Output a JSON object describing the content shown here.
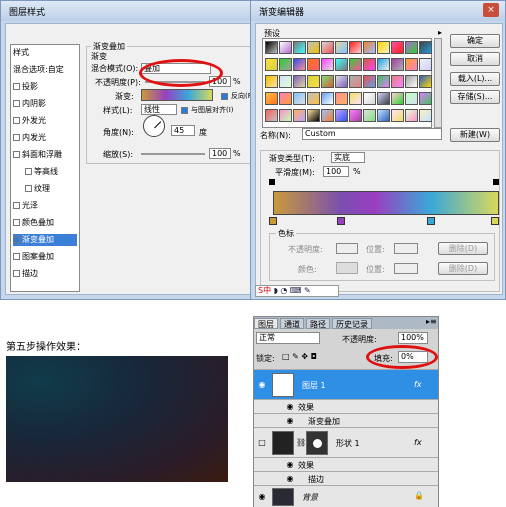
{
  "layer_style": {
    "title": "图层样式",
    "left_items": [
      {
        "label": "样式",
        "check": false,
        "sel": false,
        "nobox": true
      },
      {
        "label": "混合选项:自定",
        "check": false,
        "sel": false,
        "nobox": true
      },
      {
        "label": "投影",
        "check": false,
        "sel": false
      },
      {
        "label": "内阴影",
        "check": false,
        "sel": false
      },
      {
        "label": "外发光",
        "check": false,
        "sel": false
      },
      {
        "label": "内发光",
        "check": false,
        "sel": false
      },
      {
        "label": "斜面和浮雕",
        "check": false,
        "sel": false
      },
      {
        "label": "等高线",
        "check": false,
        "sel": false,
        "indent": true
      },
      {
        "label": "纹理",
        "check": false,
        "sel": false,
        "indent": true
      },
      {
        "label": "光泽",
        "check": false,
        "sel": false
      },
      {
        "label": "颜色叠加",
        "check": false,
        "sel": false
      },
      {
        "label": "渐变叠加",
        "check": true,
        "sel": true
      },
      {
        "label": "图案叠加",
        "check": false,
        "sel": false
      },
      {
        "label": "描边",
        "check": false,
        "sel": false
      }
    ],
    "section_title": "渐变叠加",
    "sub_title": "渐变",
    "blend_label": "混合模式(O):",
    "blend_value": "叠加",
    "opacity_label": "不透明度(P):",
    "opacity_value": "100",
    "pct": "%",
    "gradient_label": "渐变:",
    "reverse_label": "反向(R)",
    "style_label": "样式(L):",
    "style_value": "线性",
    "align_label": "与图层对齐(I)",
    "angle_label": "角度(N):",
    "angle_value": "45",
    "degree": "度",
    "scale_label": "缩放(S):",
    "scale_value": "100"
  },
  "gradient_editor": {
    "title": "渐变编辑器",
    "presets_label": "预设",
    "ok": "确定",
    "cancel": "取消",
    "load": "载入(L)...",
    "save": "存储(S)...",
    "name_label": "名称(N):",
    "name_value": "Custom",
    "new_button": "新建(W)",
    "type_label": "渐变类型(T):",
    "type_value": "实底",
    "smooth_label": "平滑度(M):",
    "smooth_value": "100",
    "pct": "%",
    "stops_label": "色标",
    "opacity_label": "不透明度:",
    "location_label": "位置:",
    "delete_label": "删除(D)",
    "color_label": "颜色:",
    "location2_label": "位置:",
    "delete2_label": "删除(D)",
    "ime_text": "S中",
    "swatch_colors": [
      "#000000",
      "#ffffff",
      "#7a7a7a",
      "#c0c0c0",
      "#d8d8d8",
      "#e0d5a0",
      "#ff2020",
      "#f08030",
      "#ffd700",
      "#ff50a0",
      "#b06ad0",
      "#404040",
      "#ffe040",
      "#2fd030",
      "#3050f0",
      "#ff7020",
      "#ff40ff",
      "#40ffff",
      "#2fd030",
      "#d06030",
      "#20a0e0",
      "#a040a0",
      "#ffa030",
      "#f0f0f0",
      "#f0c000",
      "#d0e0f0",
      "#8060c0",
      "#d0d040",
      "#80e080",
      "#e0e0e0",
      "#b0b0b0",
      "#f05050",
      "#40c060",
      "#e08080",
      "#a0a0a0",
      "#3060c0",
      "#ffc040",
      "#ff80c0",
      "#80c0ff",
      "#c0c0c0",
      "#60a0f0",
      "#ff9090",
      "#f0e060",
      "#ffffff",
      "#d0d0ff",
      "#ffd0d0",
      "#c0ffc0",
      "#e080ff",
      "#ff6060",
      "#ff90c0",
      "#ffb060",
      "#ffe0a0",
      "#a0c0ff",
      "#c0a0ff",
      "#ff80ff",
      "#e0e0e0",
      "#c0e0ff",
      "#ffe0ff",
      "#e0ffe0",
      "#fff0c0"
    ]
  },
  "result": {
    "caption": "第五步操作效果："
  },
  "layers": {
    "tabs": [
      "图层",
      "通道",
      "路径",
      "历史记录"
    ],
    "blend_mode": "正常",
    "opacity_label": "不透明度:",
    "opacity_value": "100%",
    "lock_label": "锁定:",
    "fill_label": "填充:",
    "fill_value": "0%",
    "layer1_name": "图层 1",
    "effects_label": "效果",
    "effect1": "渐变叠加",
    "shape_name": "形状 1",
    "effects2_label": "效果",
    "effect2": "描边",
    "bg_name": "背景",
    "fx": "fx"
  }
}
